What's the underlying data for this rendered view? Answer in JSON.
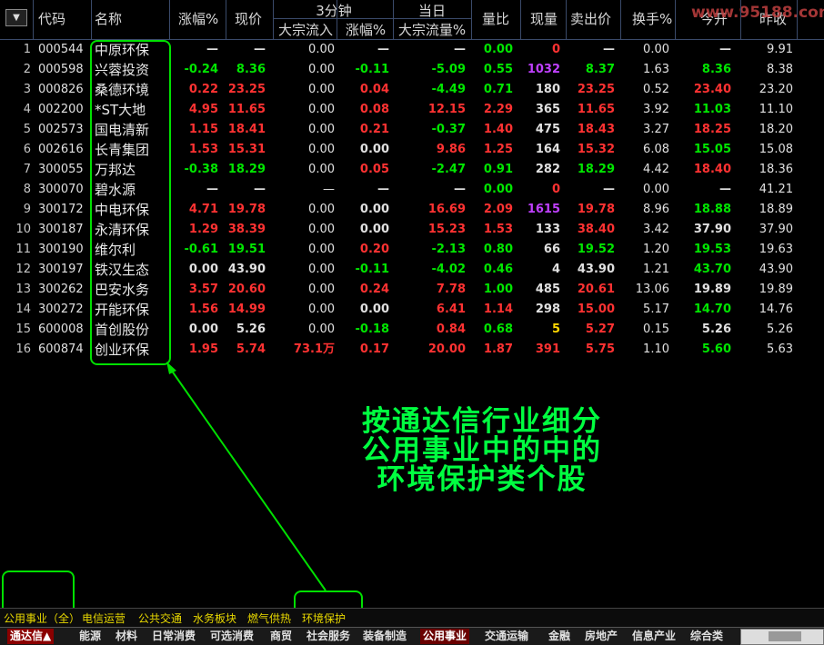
{
  "header": {
    "code": "代码",
    "name": "名称",
    "pct": "涨幅%",
    "price": "现价",
    "group3min": "3分钟",
    "dz_in": "大宗流入",
    "pct3": "涨幅%",
    "group_today": "当日",
    "dz_flow_pct": "大宗流量%",
    "vol_ratio": "量比",
    "cur_vol": "现量",
    "sell_price": "卖出价",
    "turnover": "换手%",
    "open": "今开",
    "prev_close": "昨收"
  },
  "watermark": "www.95188.com",
  "rows": [
    {
      "i": "1",
      "code": "000544",
      "name": "中原环保",
      "pct": "—",
      "price": "—",
      "dz": "0.00",
      "p3": "—",
      "dzp": "—",
      "vr": "0.00",
      "cv": "0",
      "sp": "—",
      "to": "0.00",
      "op": "—",
      "pc": "9.91",
      "cls": {
        "pct": "white",
        "price": "white",
        "p3": "white",
        "dzp": "white",
        "vr": "green",
        "cv": "red",
        "sp": "white",
        "op": "white"
      }
    },
    {
      "i": "2",
      "code": "000598",
      "name": "兴蓉投资",
      "pct": "-0.24",
      "price": "8.36",
      "dz": "0.00",
      "p3": "-0.11",
      "dzp": "-5.09",
      "vr": "0.55",
      "cv": "1032",
      "sp": "8.37",
      "to": "1.63",
      "op": "8.36",
      "pc": "8.38",
      "cls": {
        "pct": "green",
        "price": "green",
        "p3": "green",
        "dzp": "green",
        "vr": "green",
        "cv": "purple",
        "sp": "green",
        "op": "green"
      }
    },
    {
      "i": "3",
      "code": "000826",
      "name": "桑德环境",
      "pct": "0.22",
      "price": "23.25",
      "dz": "0.00",
      "p3": "0.04",
      "dzp": "-4.49",
      "vr": "0.71",
      "cv": "180",
      "sp": "23.25",
      "to": "0.52",
      "op": "23.40",
      "pc": "23.20",
      "cls": {
        "pct": "red",
        "price": "red",
        "p3": "red",
        "dzp": "green",
        "vr": "green",
        "cv": "white",
        "sp": "red",
        "op": "red"
      }
    },
    {
      "i": "4",
      "code": "002200",
      "name": "*ST大地",
      "pct": "4.95",
      "price": "11.65",
      "dz": "0.00",
      "p3": "0.08",
      "dzp": "12.15",
      "vr": "2.29",
      "cv": "365",
      "sp": "11.65",
      "to": "3.92",
      "op": "11.03",
      "pc": "11.10",
      "cls": {
        "pct": "red",
        "price": "red",
        "p3": "red",
        "dzp": "red",
        "vr": "red",
        "cv": "white",
        "sp": "red",
        "op": "green"
      }
    },
    {
      "i": "5",
      "code": "002573",
      "name": "国电清新",
      "pct": "1.15",
      "price": "18.41",
      "dz": "0.00",
      "p3": "0.21",
      "dzp": "-0.37",
      "vr": "1.40",
      "cv": "475",
      "sp": "18.43",
      "to": "3.27",
      "op": "18.25",
      "pc": "18.20",
      "cls": {
        "pct": "red",
        "price": "red",
        "p3": "red",
        "dzp": "green",
        "vr": "red",
        "cv": "white",
        "sp": "red",
        "op": "red"
      }
    },
    {
      "i": "6",
      "code": "002616",
      "name": "长青集团",
      "pct": "1.53",
      "price": "15.31",
      "dz": "0.00",
      "p3": "0.00",
      "dzp": "9.86",
      "vr": "1.25",
      "cv": "164",
      "sp": "15.32",
      "to": "6.08",
      "op": "15.05",
      "pc": "15.08",
      "cls": {
        "pct": "red",
        "price": "red",
        "p3": "white",
        "dzp": "red",
        "vr": "red",
        "cv": "white",
        "sp": "red",
        "op": "green"
      }
    },
    {
      "i": "7",
      "code": "300055",
      "name": "万邦达",
      "pct": "-0.38",
      "price": "18.29",
      "dz": "0.00",
      "p3": "0.05",
      "dzp": "-2.47",
      "vr": "0.91",
      "cv": "282",
      "sp": "18.29",
      "to": "4.42",
      "op": "18.40",
      "pc": "18.36",
      "cls": {
        "pct": "green",
        "price": "green",
        "p3": "red",
        "dzp": "green",
        "vr": "green",
        "cv": "white",
        "sp": "green",
        "op": "red"
      }
    },
    {
      "i": "8",
      "code": "300070",
      "name": "碧水源",
      "pct": "—",
      "price": "—",
      "dz": "—",
      "p3": "—",
      "dzp": "—",
      "vr": "0.00",
      "cv": "0",
      "sp": "—",
      "to": "0.00",
      "op": "—",
      "pc": "41.21",
      "cls": {
        "pct": "white",
        "price": "white",
        "p3": "white",
        "dzp": "white",
        "vr": "green",
        "cv": "red",
        "sp": "white",
        "op": "white"
      }
    },
    {
      "i": "9",
      "code": "300172",
      "name": "中电环保",
      "pct": "4.71",
      "price": "19.78",
      "dz": "0.00",
      "p3": "0.00",
      "dzp": "16.69",
      "vr": "2.09",
      "cv": "1615",
      "sp": "19.78",
      "to": "8.96",
      "op": "18.88",
      "pc": "18.89",
      "cls": {
        "pct": "red",
        "price": "red",
        "p3": "white",
        "dzp": "red",
        "vr": "red",
        "cv": "purple",
        "sp": "red",
        "op": "green"
      }
    },
    {
      "i": "10",
      "code": "300187",
      "name": "永清环保",
      "pct": "1.29",
      "price": "38.39",
      "dz": "0.00",
      "p3": "0.00",
      "dzp": "15.23",
      "vr": "1.53",
      "cv": "133",
      "sp": "38.40",
      "to": "3.42",
      "op": "37.90",
      "pc": "37.90",
      "cls": {
        "pct": "red",
        "price": "red",
        "p3": "white",
        "dzp": "red",
        "vr": "red",
        "cv": "white",
        "sp": "red",
        "op": "white"
      }
    },
    {
      "i": "11",
      "code": "300190",
      "name": "维尔利",
      "pct": "-0.61",
      "price": "19.51",
      "dz": "0.00",
      "p3": "0.20",
      "dzp": "-2.13",
      "vr": "0.80",
      "cv": "66",
      "sp": "19.52",
      "to": "1.20",
      "op": "19.53",
      "pc": "19.63",
      "cls": {
        "pct": "green",
        "price": "green",
        "p3": "red",
        "dzp": "green",
        "vr": "green",
        "cv": "white",
        "sp": "green",
        "op": "green"
      }
    },
    {
      "i": "12",
      "code": "300197",
      "name": "铁汉生态",
      "pct": "0.00",
      "price": "43.90",
      "dz": "0.00",
      "p3": "-0.11",
      "dzp": "-4.02",
      "vr": "0.46",
      "cv": "4",
      "sp": "43.90",
      "to": "1.21",
      "op": "43.70",
      "pc": "43.90",
      "cls": {
        "pct": "white",
        "price": "white",
        "p3": "green",
        "dzp": "green",
        "vr": "green",
        "cv": "white",
        "sp": "white",
        "op": "green"
      }
    },
    {
      "i": "13",
      "code": "300262",
      "name": "巴安水务",
      "pct": "3.57",
      "price": "20.60",
      "dz": "0.00",
      "p3": "0.24",
      "dzp": "7.78",
      "vr": "1.00",
      "cv": "485",
      "sp": "20.61",
      "to": "13.06",
      "op": "19.89",
      "pc": "19.89",
      "cls": {
        "pct": "red",
        "price": "red",
        "p3": "red",
        "dzp": "red",
        "vr": "green",
        "cv": "white",
        "sp": "red",
        "op": "white"
      }
    },
    {
      "i": "14",
      "code": "300272",
      "name": "开能环保",
      "pct": "1.56",
      "price": "14.99",
      "dz": "0.00",
      "p3": "0.00",
      "dzp": "6.41",
      "vr": "1.14",
      "cv": "298",
      "sp": "15.00",
      "to": "5.17",
      "op": "14.70",
      "pc": "14.76",
      "cls": {
        "pct": "red",
        "price": "red",
        "p3": "white",
        "dzp": "red",
        "vr": "red",
        "cv": "white",
        "sp": "red",
        "op": "green"
      }
    },
    {
      "i": "15",
      "code": "600008",
      "name": "首创股份",
      "pct": "0.00",
      "price": "5.26",
      "dz": "0.00",
      "p3": "-0.18",
      "dzp": "0.84",
      "vr": "0.68",
      "cv": "5",
      "sp": "5.27",
      "to": "0.15",
      "op": "5.26",
      "pc": "5.26",
      "cls": {
        "pct": "white",
        "price": "white",
        "p3": "green",
        "dzp": "red",
        "vr": "green",
        "cv": "yellow",
        "sp": "red",
        "op": "white"
      }
    },
    {
      "i": "16",
      "code": "600874",
      "name": "创业环保",
      "pct": "1.95",
      "price": "5.74",
      "dz": "73.1万",
      "p3": "0.17",
      "dzp": "20.00",
      "vr": "1.87",
      "cv": "391",
      "sp": "5.75",
      "to": "1.10",
      "op": "5.60",
      "pc": "5.63",
      "cls": {
        "pct": "red",
        "price": "red",
        "dz": "red",
        "p3": "red",
        "dzp": "red",
        "vr": "red",
        "cv": "red",
        "sp": "red",
        "op": "green"
      }
    }
  ],
  "annotation": {
    "line1": "按通达信行业细分",
    "line2": "公用事业中的中的",
    "line3": "环境保护类个股"
  },
  "tabs1": [
    "公用事业（全）",
    "电信运营",
    "公共交通",
    "水务板块",
    "燃气供热",
    "环境保护"
  ],
  "tabs2": [
    "通达信▲",
    "能源",
    "材料",
    "日常消费",
    "可选消费",
    "商贸",
    "社会服务",
    "装备制造",
    "公用事业",
    "交通运输",
    "金融",
    "房地产",
    "信息产业",
    "综合类"
  ]
}
